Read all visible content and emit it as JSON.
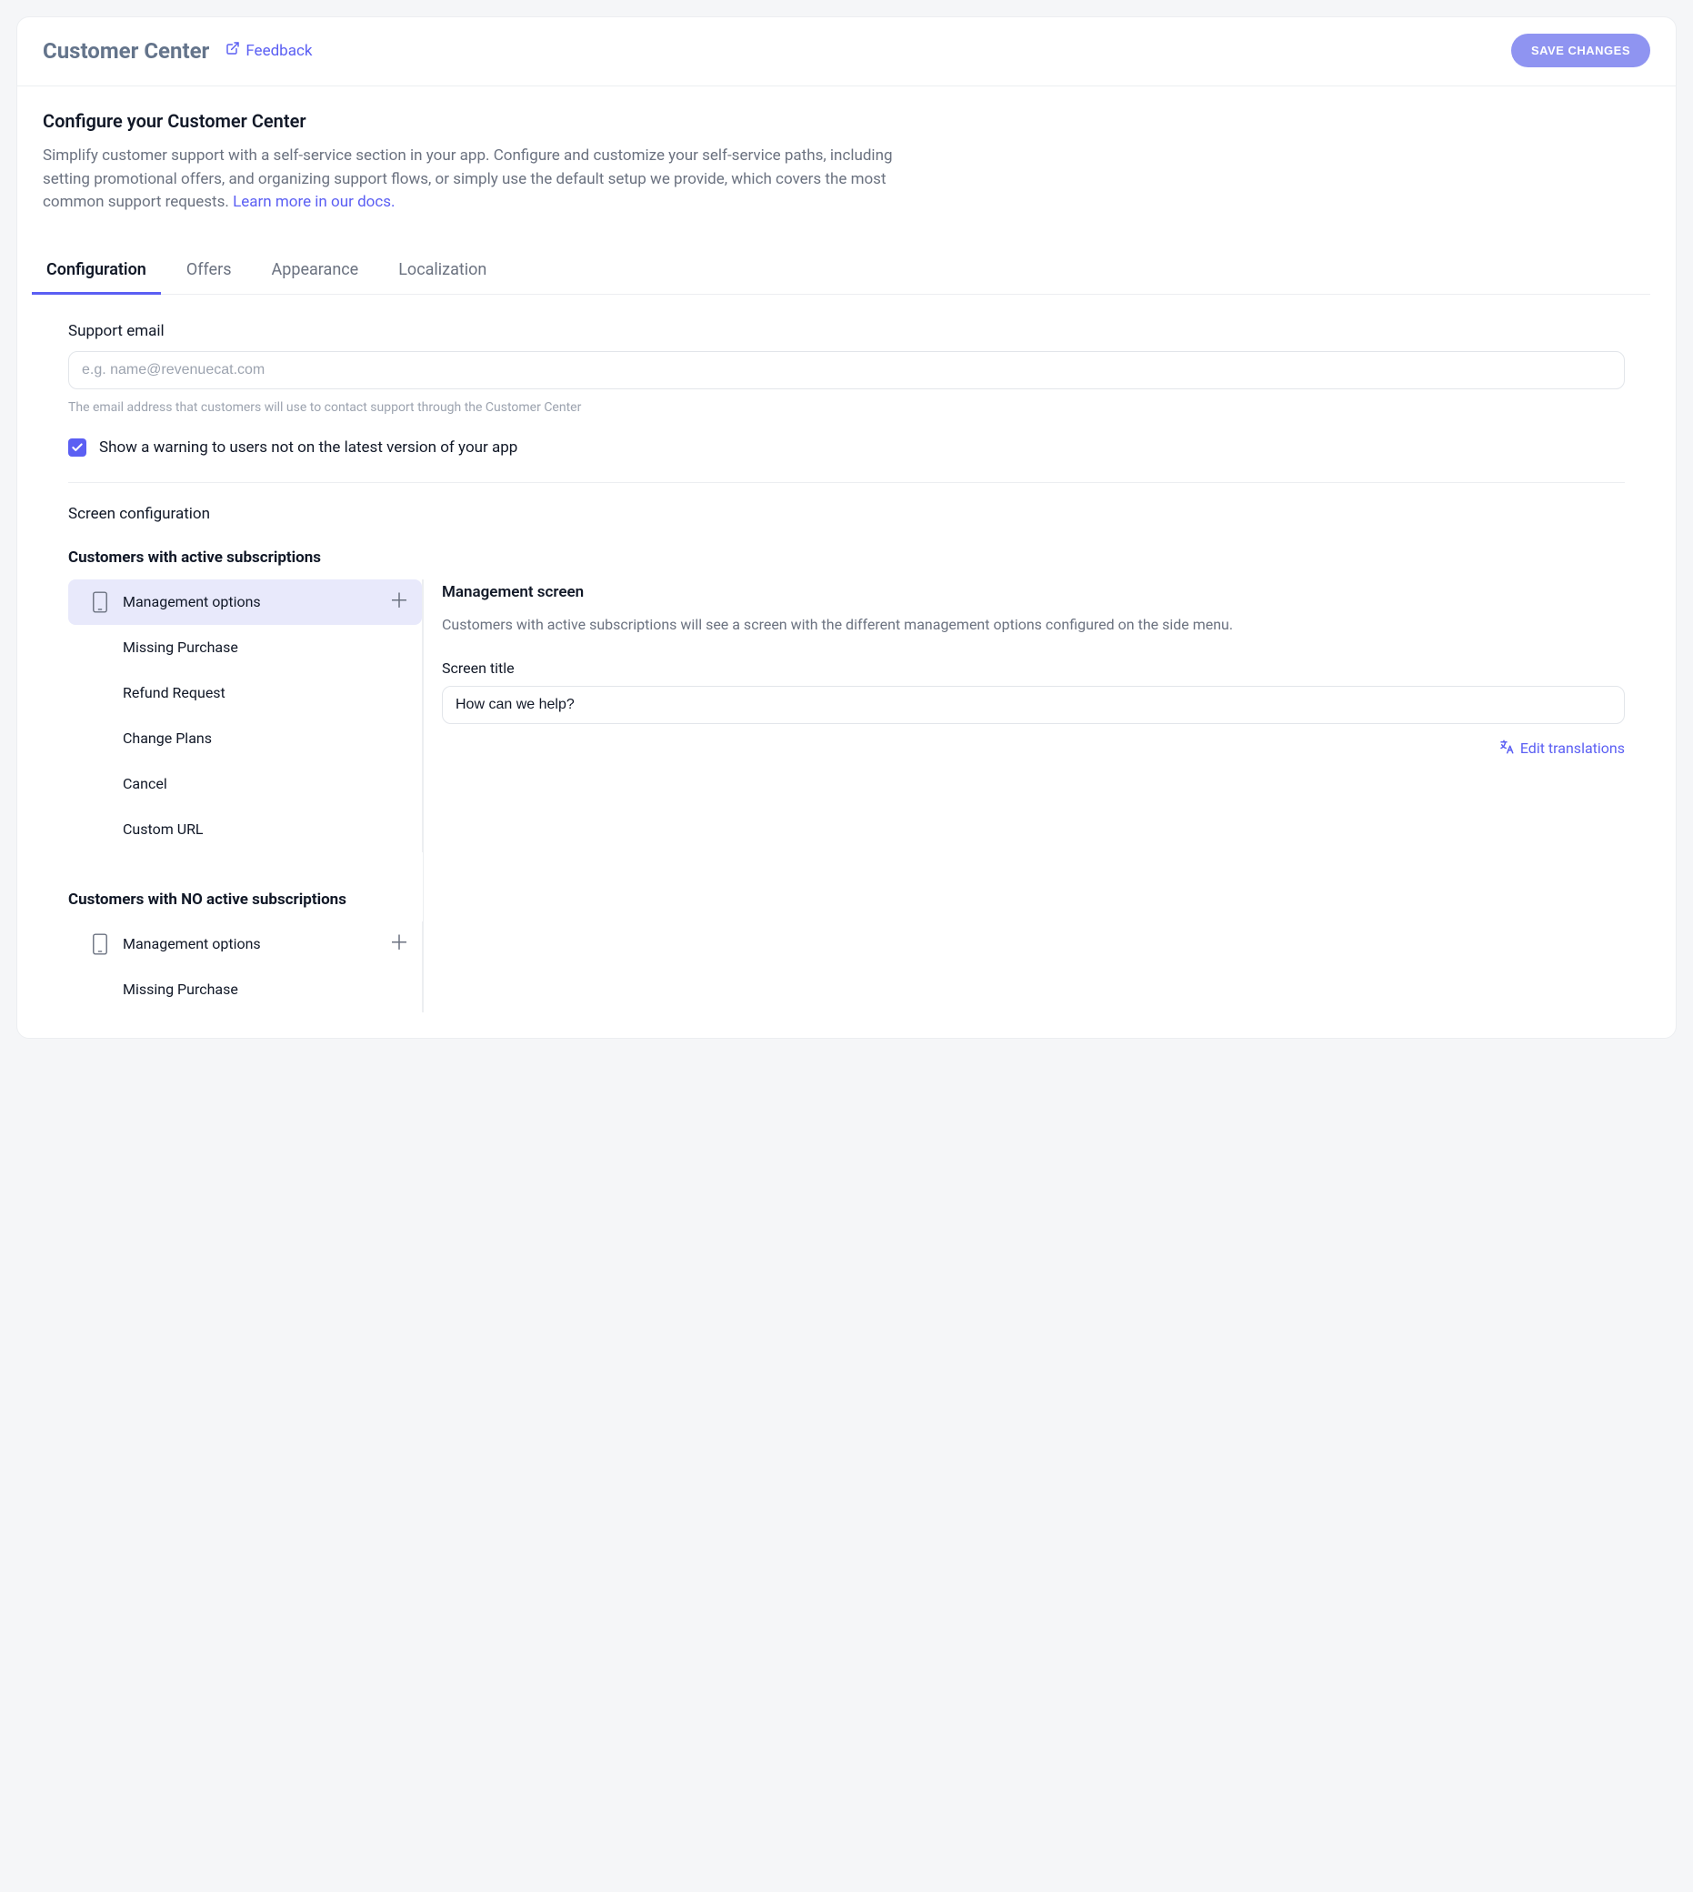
{
  "header": {
    "title": "Customer Center",
    "feedback_label": "Feedback",
    "save_label": "SAVE CHANGES"
  },
  "intro": {
    "heading": "Configure your Customer Center",
    "desc_before": "Simplify customer support with a self-service section in your app. Configure and customize your self-service paths, including setting promotional offers, and organizing support flows, or simply use the default setup we provide, which covers the most common support requests. ",
    "learn_more": "Learn more in our docs."
  },
  "tabs": [
    "Configuration",
    "Offers",
    "Appearance",
    "Localization"
  ],
  "active_tab_index": 0,
  "support_email": {
    "label": "Support email",
    "placeholder": "e.g. name@revenuecat.com",
    "value": "",
    "hint": "The email address that customers will use to contact support through the Customer Center"
  },
  "warning_checkbox": {
    "checked": true,
    "label": "Show a warning to users not on the latest version of your app"
  },
  "screen_config": {
    "title": "Screen configuration",
    "group1": {
      "heading": "Customers with active subscriptions",
      "root": "Management options",
      "items": [
        "Missing Purchase",
        "Refund Request",
        "Change Plans",
        "Cancel",
        "Custom URL"
      ]
    },
    "group2": {
      "heading": "Customers with NO active subscriptions",
      "root": "Management options",
      "items": [
        "Missing Purchase"
      ]
    },
    "right": {
      "heading": "Management screen",
      "desc": "Customers with active subscriptions will see a screen with the different management options configured on the side menu.",
      "screen_title_label": "Screen title",
      "screen_title_value": "How can we help?",
      "edit_translations": "Edit translations"
    }
  }
}
